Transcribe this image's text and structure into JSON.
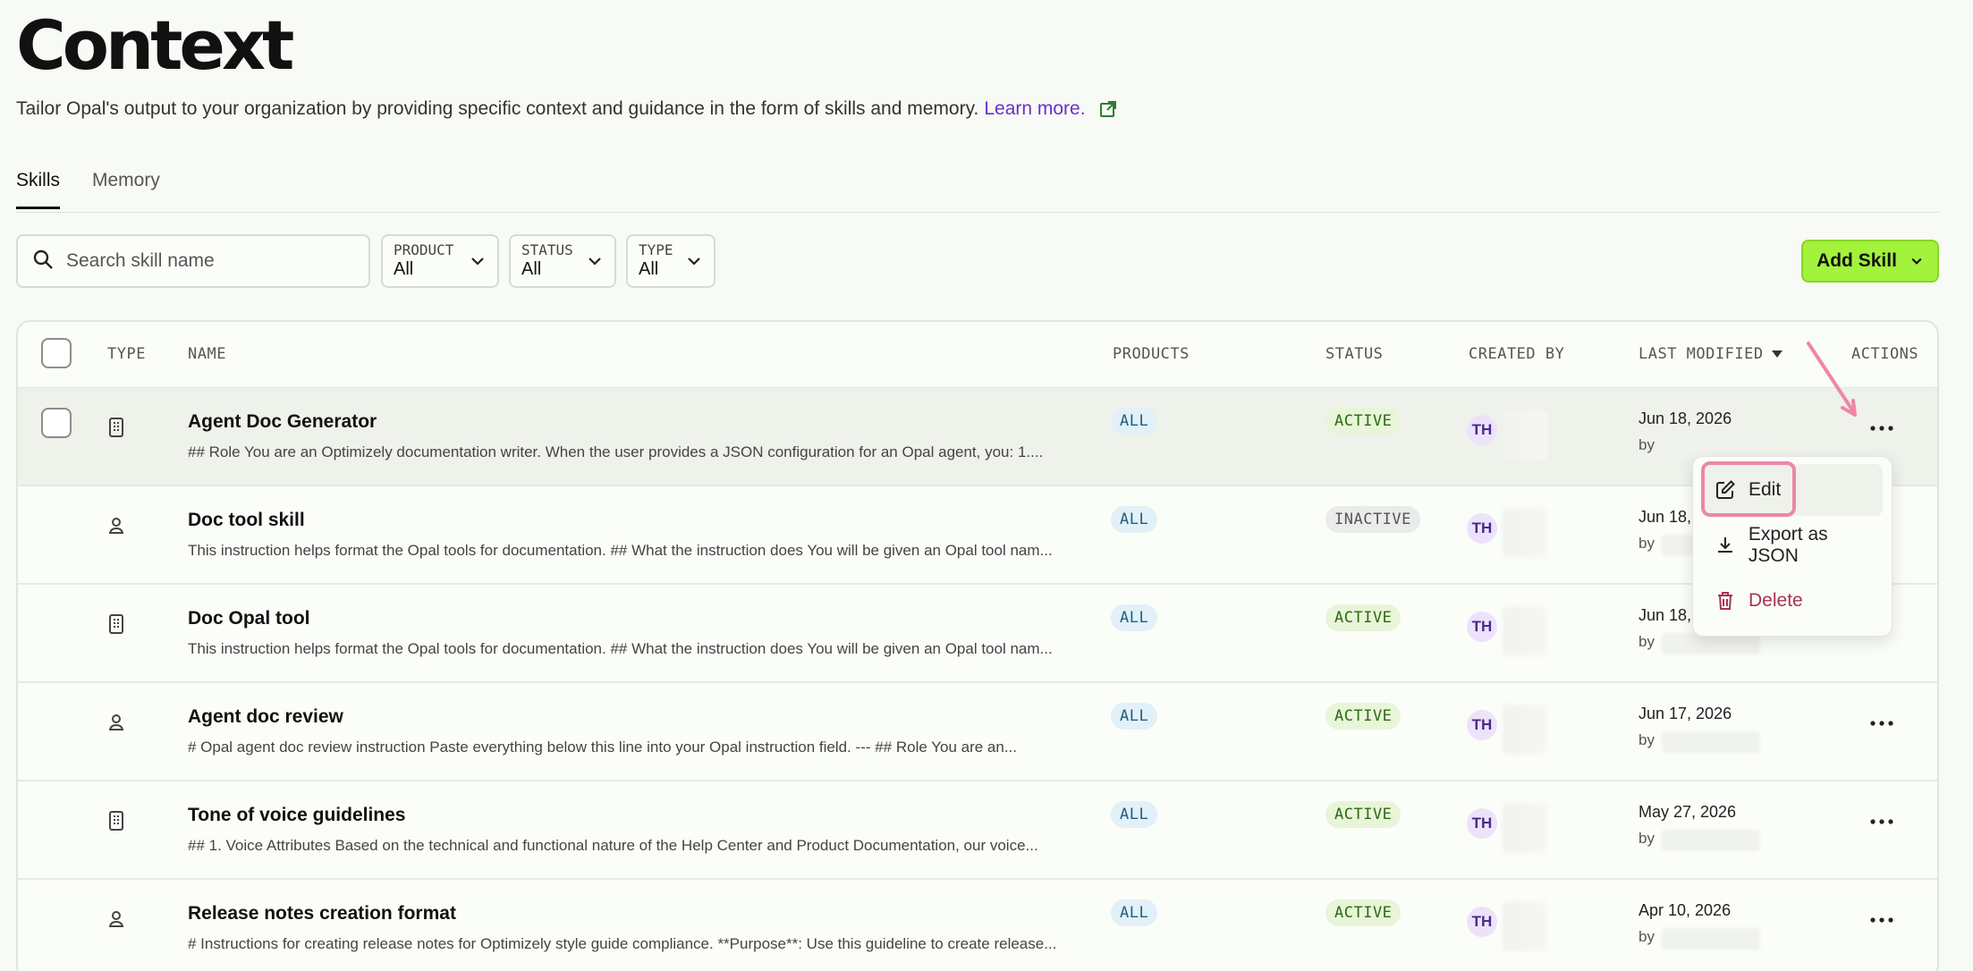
{
  "page": {
    "title": "Context",
    "subtitle": "Tailor Opal's output to your organization by providing specific context and guidance in the form of skills and memory.",
    "learn_more": "Learn more."
  },
  "tabs": [
    {
      "label": "Skills",
      "active": true
    },
    {
      "label": "Memory",
      "active": false
    }
  ],
  "toolbar": {
    "search_placeholder": "Search skill name",
    "filters": [
      {
        "label": "PRODUCT",
        "value": "All"
      },
      {
        "label": "STATUS",
        "value": "All"
      },
      {
        "label": "TYPE",
        "value": "All"
      }
    ],
    "add_skill_label": "Add Skill"
  },
  "table": {
    "headers": {
      "type": "TYPE",
      "name": "NAME",
      "products": "PRODUCTS",
      "status": "STATUS",
      "created_by": "CREATED BY",
      "last_modified": "LAST MODIFIED",
      "actions": "ACTIONS"
    },
    "rows": [
      {
        "type_icon": "building-icon",
        "name": "Agent Doc Generator",
        "desc": "## Role You are an Optimizely documentation writer. When the user provides a JSON configuration for an Opal agent, you: 1....",
        "product": "ALL",
        "status": "ACTIVE",
        "creator_initials": "TH",
        "modified": "Jun 18, 2026",
        "by": "by"
      },
      {
        "type_icon": "person-icon",
        "name": "Doc tool skill",
        "desc": "This instruction helps format the Opal tools for documentation. ## What the instruction does You will be given an Opal tool nam...",
        "product": "ALL",
        "status": "INACTIVE",
        "creator_initials": "TH",
        "modified": "Jun 18, 2",
        "by": "by"
      },
      {
        "type_icon": "building-icon",
        "name": "Doc Opal tool",
        "desc": "This instruction helps format the Opal tools for documentation. ## What the instruction does You will be given an Opal tool nam...",
        "product": "ALL",
        "status": "ACTIVE",
        "creator_initials": "TH",
        "modified": "Jun 18, 2",
        "by": "by"
      },
      {
        "type_icon": "person-icon",
        "name": "Agent doc review",
        "desc": "# Opal agent doc review instruction Paste everything below this line into your Opal instruction field. --- ## Role You are an...",
        "product": "ALL",
        "status": "ACTIVE",
        "creator_initials": "TH",
        "modified": "Jun 17, 2026",
        "by": "by"
      },
      {
        "type_icon": "building-icon",
        "name": "Tone of voice guidelines",
        "desc": "## 1. Voice Attributes Based on the technical and functional nature of the Help Center and Product Documentation, our voice...",
        "product": "ALL",
        "status": "ACTIVE",
        "creator_initials": "TH",
        "modified": "May 27, 2026",
        "by": "by"
      },
      {
        "type_icon": "person-icon",
        "name": "Release notes creation format",
        "desc": "# Instructions for creating release notes for Optimizely style guide compliance. **Purpose**: Use this guideline to create release...",
        "product": "ALL",
        "status": "ACTIVE",
        "creator_initials": "TH",
        "modified": "Apr 10, 2026",
        "by": "by"
      }
    ]
  },
  "menu": {
    "edit": "Edit",
    "export": "Export as JSON",
    "delete": "Delete"
  },
  "colors": {
    "accent": "#a3f23c",
    "link": "#6a30c8",
    "highlight": "#ee86a8",
    "delete": "#a83258"
  }
}
